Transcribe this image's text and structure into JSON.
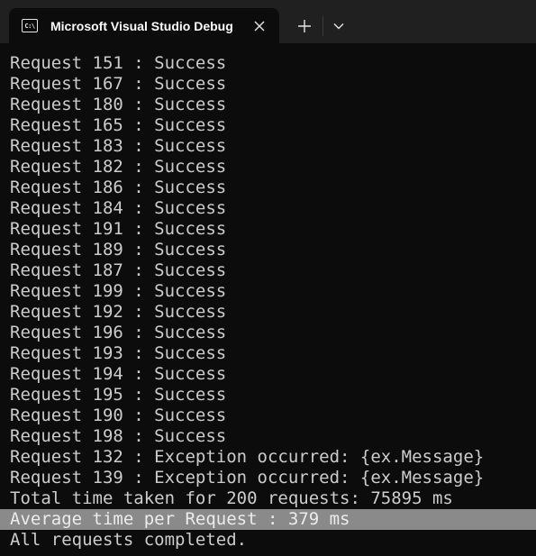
{
  "window": {
    "tab_title": "Microsoft Visual Studio Debug Console",
    "icon": "console-app-icon",
    "icon_glyph": "C:\\",
    "close_icon": "close-icon",
    "new_tab_icon": "plus-icon",
    "dropdown_icon": "chevron-down-icon"
  },
  "console": {
    "lines": [
      "Request 151 : Success",
      "Request 167 : Success",
      "Request 180 : Success",
      "Request 165 : Success",
      "Request 183 : Success",
      "Request 182 : Success",
      "Request 186 : Success",
      "Request 184 : Success",
      "Request 191 : Success",
      "Request 189 : Success",
      "Request 187 : Success",
      "Request 199 : Success",
      "Request 192 : Success",
      "Request 196 : Success",
      "Request 193 : Success",
      "Request 194 : Success",
      "Request 195 : Success",
      "Request 190 : Success",
      "Request 198 : Success",
      "Request 132 : Exception occurred: {ex.Message}",
      "Request 139 : Exception occurred: {ex.Message}",
      "Total time taken for 200 requests: 75895 ms",
      "Average time per Request : 379 ms",
      "All requests completed."
    ],
    "selected_line_index": 22
  },
  "colors": {
    "background": "#0c0c0c",
    "titlebar": "#202020",
    "text": "#cccccc",
    "selection": "#8a8a8a"
  }
}
